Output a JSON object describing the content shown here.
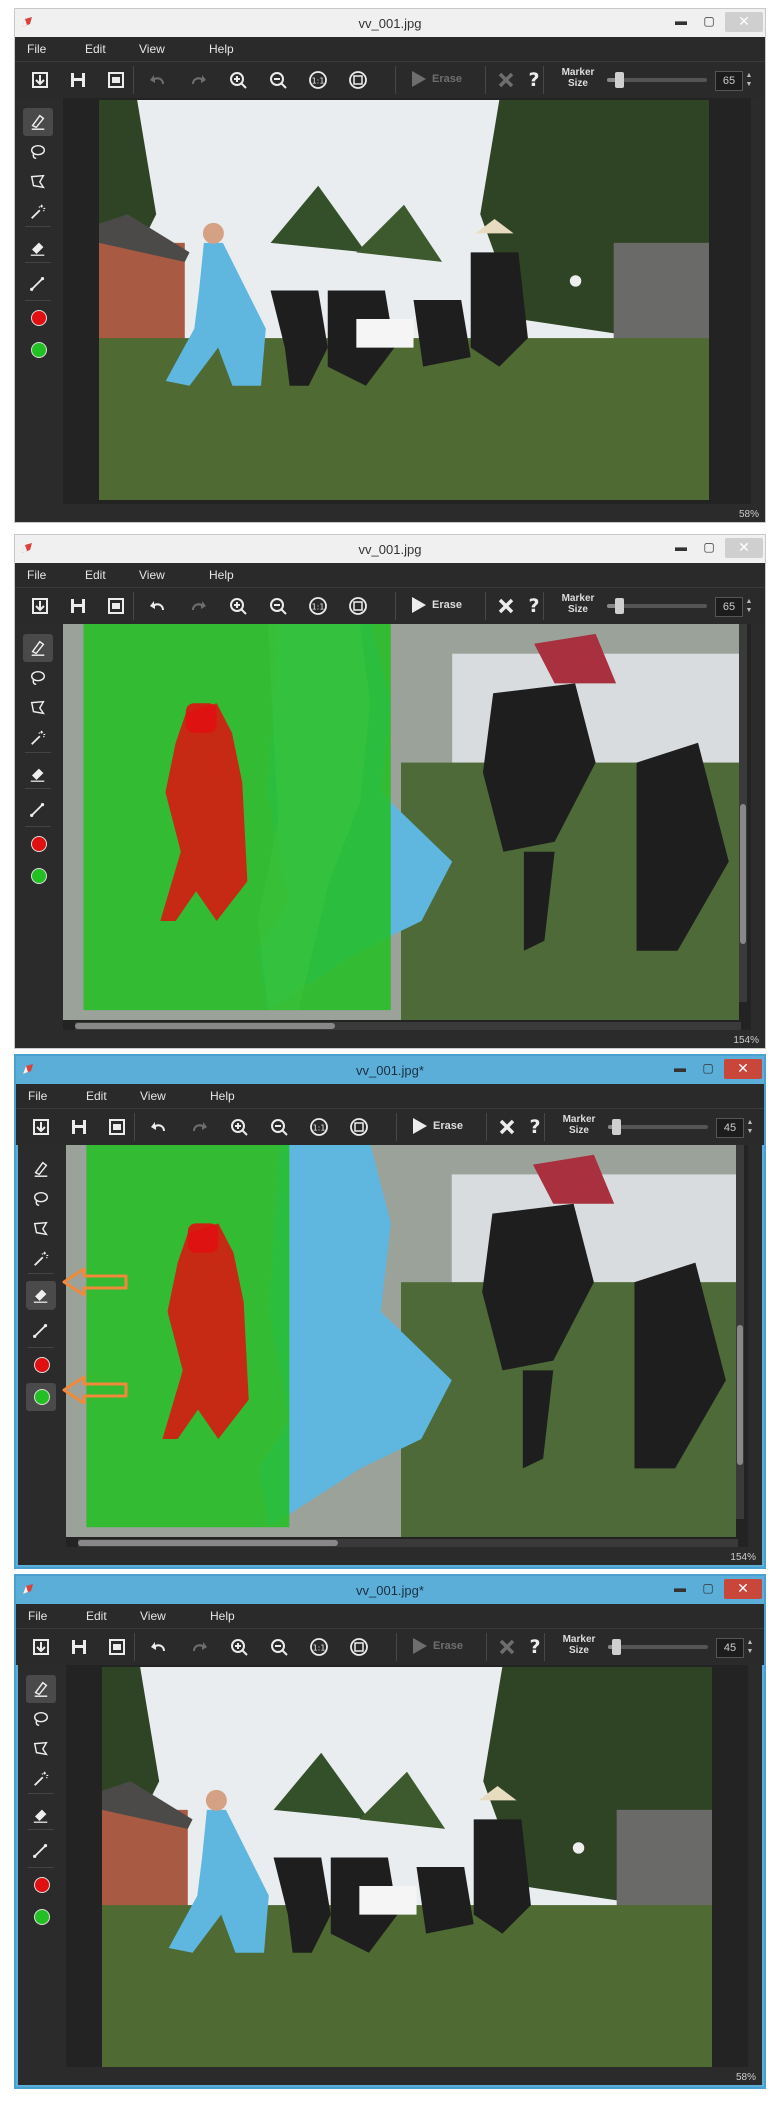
{
  "windows": [
    {
      "title": "vv_001.jpg",
      "active": false,
      "menu": [
        "File",
        "Edit",
        "View",
        "Help"
      ],
      "undo_enabled": false,
      "redo_enabled": false,
      "erase_enabled": false,
      "erase_label": "Erase",
      "marker_label": "Marker Size",
      "marker_size": "65",
      "marker_fraction": 0.12,
      "zoom": "58%",
      "view": "full",
      "selected_tool": "marker",
      "highlighted_tool": "",
      "arrows": false
    },
    {
      "title": "vv_001.jpg",
      "active": false,
      "menu": [
        "File",
        "Edit",
        "View",
        "Help"
      ],
      "undo_enabled": true,
      "redo_enabled": false,
      "erase_enabled": true,
      "erase_label": "Erase",
      "marker_label": "Marker Size",
      "marker_size": "65",
      "marker_fraction": 0.12,
      "zoom": "154%",
      "view": "zoomed-masked",
      "selected_tool": "marker",
      "highlighted_tool": "",
      "arrows": false
    },
    {
      "title": "vv_001.jpg*",
      "active": true,
      "menu": [
        "File",
        "Edit",
        "View",
        "Help"
      ],
      "undo_enabled": true,
      "redo_enabled": false,
      "erase_enabled": true,
      "erase_label": "Erase",
      "marker_label": "Marker Size",
      "marker_size": "45",
      "marker_fraction": 0.08,
      "zoom": "154%",
      "view": "zoomed-erased",
      "selected_tool": "eraser",
      "highlighted_tool": "green",
      "arrows": true
    },
    {
      "title": "vv_001.jpg*",
      "active": true,
      "menu": [
        "File",
        "Edit",
        "View",
        "Help"
      ],
      "undo_enabled": true,
      "redo_enabled": false,
      "erase_enabled": false,
      "erase_label": "Erase",
      "marker_label": "Marker Size",
      "marker_size": "45",
      "marker_fraction": 0.08,
      "zoom": "58%",
      "view": "full",
      "selected_tool": "marker",
      "highlighted_tool": "",
      "arrows": false
    }
  ],
  "colors": {
    "foreground_marker": "#e01010",
    "background_marker": "#22c022",
    "annotation_arrow": "#f08a3a"
  },
  "icons": {
    "toolbar": [
      "open-icon",
      "save-icon",
      "save-as-icon",
      "undo-icon",
      "redo-icon",
      "zoom-in-icon",
      "zoom-out-icon",
      "actual-size-icon",
      "fit-window-icon",
      "erase-play-icon",
      "clear-icon",
      "help-icon"
    ],
    "sidebar": [
      "marker-icon",
      "lasso-icon",
      "polygon-lasso-icon",
      "magic-wand-icon",
      "eraser-icon",
      "line-icon",
      "red-marker-icon",
      "green-marker-icon"
    ]
  }
}
